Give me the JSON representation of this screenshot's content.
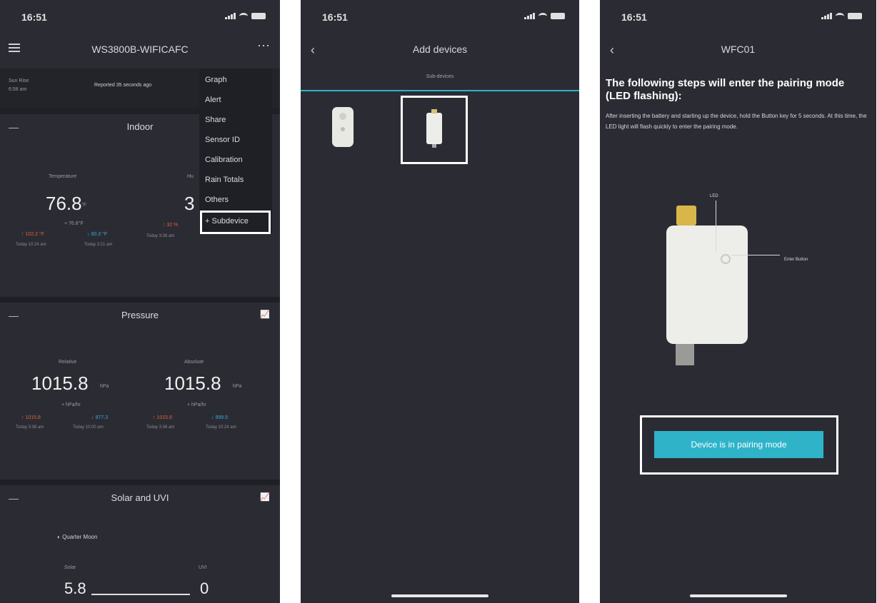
{
  "status": {
    "time": "16:51"
  },
  "screen1": {
    "title": "WS3800B-WIFICAFC",
    "sunrise_label": "Sun Rise",
    "sunrise_time": "6:58 am",
    "reported": "Reported 35 seconds ago",
    "menu": [
      "Graph",
      "Alert",
      "Share",
      "Sensor ID",
      "Calibration",
      "Rain Totals",
      "Others",
      "+ Subdevice"
    ],
    "indoor": {
      "title": "Indoor",
      "temp_label": "Temperature",
      "temp_value": "76.8",
      "temp_unit": "°F",
      "temp_sub": "+ 76.8°F",
      "temp_high": "↑ 102.2 °F",
      "temp_low": "↓ 60.3 °F",
      "temp_high_time": "Today 10:24 am",
      "temp_low_time": "Today 3:21 am",
      "hum_label": "Hu",
      "hum_value": "3",
      "hum_high": "↑ 32 %",
      "hum_time": "Today 3:36 am"
    },
    "pressure": {
      "title": "Pressure",
      "rel_label": "Relative",
      "rel_value": "1015.8",
      "abs_label": "Absolute",
      "abs_value": "1015.8",
      "unit": "hPa",
      "rel_sub": "+ hPa/hr",
      "abs_sub": "+ hPa/hr",
      "rel_high": "↑ 1015.8",
      "rel_low": "↓ 977.3",
      "abs_high": "↑ 1015.8",
      "abs_low": "↓ 999.5",
      "rel_high_time": "Today 3:36 am",
      "rel_low_time": "Today 10:00 am",
      "abs_high_time": "Today 3:36 am",
      "abs_low_time": "Today 10:24 am"
    },
    "solar": {
      "title": "Solar and UVI",
      "moon": "Quarter Moon",
      "solar_label": "Solar",
      "solar_value": "5.8",
      "uvi_label": "UVI",
      "uvi_value": "0"
    }
  },
  "screen2": {
    "title": "Add devices",
    "tab": "Sub-devices"
  },
  "screen3": {
    "title": "WFC01",
    "heading": "The following steps will enter the pairing mode (LED flashing):",
    "body": "After inserting the battery and starting up the device, hold the Button key for 5 seconds. At this time, the LED light will flash quickly to enter the pairing mode.",
    "led_label": "LED",
    "button_label": "Enter Button",
    "pair_button": "Device is in pairing mode"
  },
  "colors": {
    "accent": "#2fb3c9",
    "background": "#2b2c33",
    "high": "#e0603a",
    "low": "#3aa8e0",
    "chart_icon": "#e8b030"
  },
  "icons": [
    "menu-icon",
    "more-icon",
    "back-icon",
    "chart-icon",
    "moon-icon",
    "signal-icon",
    "wifi-icon",
    "battery-icon"
  ]
}
